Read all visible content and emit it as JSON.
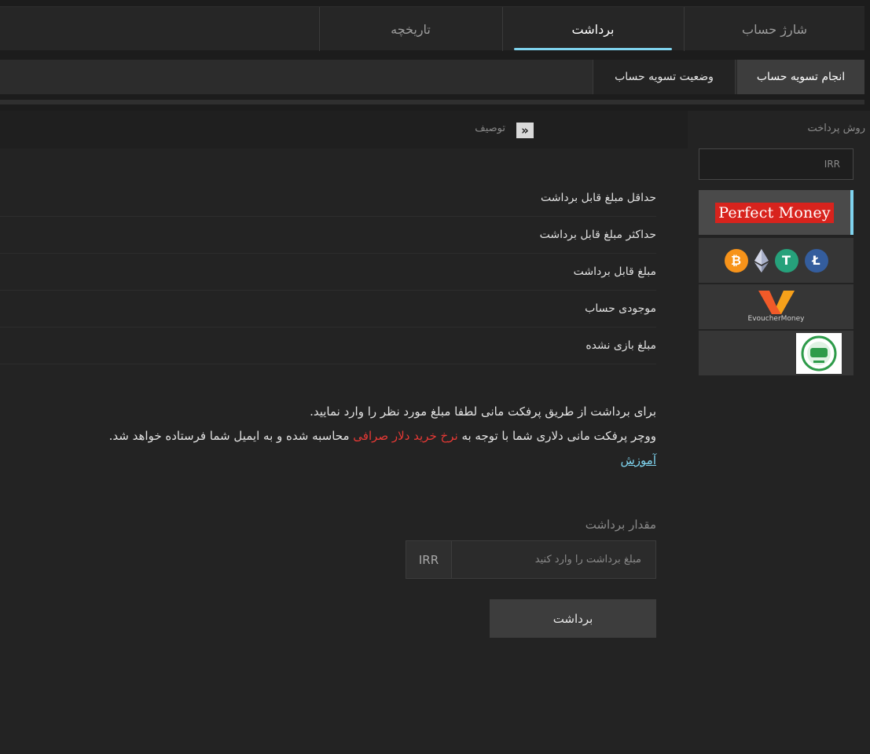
{
  "main_tabs": [
    {
      "label": "شارژ حساب",
      "active": false
    },
    {
      "label": "برداشت",
      "active": true
    },
    {
      "label": "تاریخچه",
      "active": false
    }
  ],
  "sub_tabs": [
    {
      "label": "انجام تسویه حساب",
      "active": true
    },
    {
      "label": "وضعیت تسویه حساب",
      "active": false
    }
  ],
  "sidebar": {
    "method_label": "روش پرداخت",
    "currency_value": "IRR",
    "methods": [
      {
        "name": "Perfect Money",
        "active": true
      },
      {
        "name": "crypto",
        "active": false
      },
      {
        "name": "EvoucherMoney",
        "active": false
      },
      {
        "name": "other",
        "active": false
      }
    ],
    "crypto_letters": {
      "btc": "₿",
      "usdt": "T",
      "ltc": "Ł"
    },
    "ev_label": "EvoucherMoney"
  },
  "description": {
    "title": "توصیف",
    "collapse_icon": "«"
  },
  "info_rows": [
    {
      "label": "حداقل مبلغ قابل برداشت"
    },
    {
      "label": "حداکثر مبلغ قابل برداشت"
    },
    {
      "label": "مبلغ قابل برداشت"
    },
    {
      "label": "موجودی حساب"
    },
    {
      "label": "مبلغ بازی نشده"
    }
  ],
  "notice": {
    "line1": "برای برداشت از طریق پرفکت مانی لطفا مبلغ مورد نظر را وارد نمایید.",
    "line2_before": "ووچر پرفکت مانی دلاری شما با توجه به ",
    "line2_red": "نرخ خرید دلار صرافی",
    "line2_after": " محاسبه شده و به ایمیل شما فرستاده خواهد شد.",
    "link": "آموزش"
  },
  "amount": {
    "label": "مقدار برداشت",
    "placeholder": "مبلغ برداشت را وارد کنید",
    "currency": "IRR"
  },
  "submit_label": "برداشت",
  "colors": {
    "accent": "#7fd3ee",
    "highlight_red": "#e53935",
    "pm_red": "#d8231d"
  }
}
